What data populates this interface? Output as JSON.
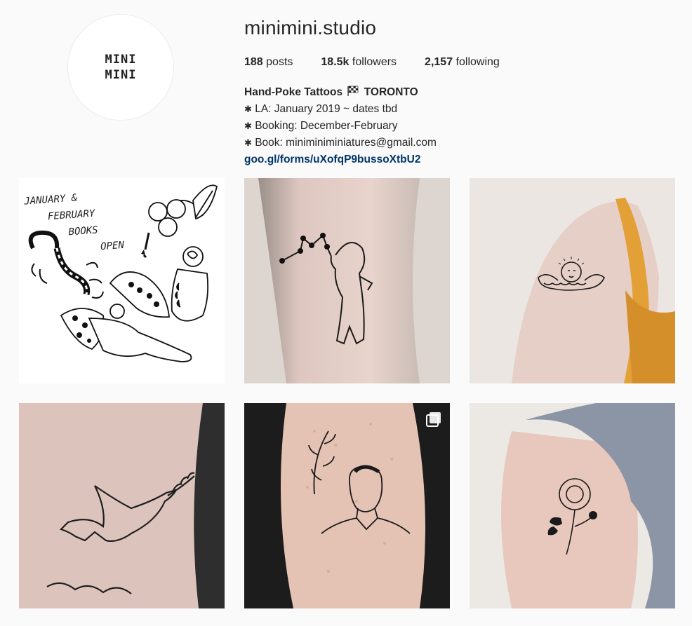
{
  "profile": {
    "avatar_text": [
      "MINI",
      "MINI"
    ],
    "username": "minimini.studio"
  },
  "stats": {
    "posts_count": "188",
    "posts_label": "posts",
    "followers_count": "18.5k",
    "followers_label": "followers",
    "following_count": "2,157",
    "following_label": "following"
  },
  "bio": {
    "name": "Hand-Poke Tattoos",
    "flag_icon": "chequered-flag-icon",
    "city": "TORONTO",
    "lines": [
      "LA: January 2019 ~ dates tbd",
      "Booking: December-February",
      "Book: miniminiminiatures@gmail.com"
    ],
    "bullet": "✱",
    "link": "goo.gl/forms/uXofqP9bussoXtbU2"
  },
  "posts": [
    {
      "subject": "flash-sheet",
      "lettering": [
        "JANUARY &",
        "FEBRUARY",
        "BOOKS",
        "OPEN"
      ]
    },
    {
      "subject": "constellation-figure-tattoo"
    },
    {
      "subject": "cherub-shoulder-tattoo"
    },
    {
      "subject": "dove-tattoo"
    },
    {
      "subject": "portrait-tattoo",
      "multiple_icon": "carousel-icon"
    },
    {
      "subject": "flower-tattoo"
    }
  ],
  "colors": {
    "link": "#003569",
    "background": "#fafafa",
    "text": "#262626"
  }
}
